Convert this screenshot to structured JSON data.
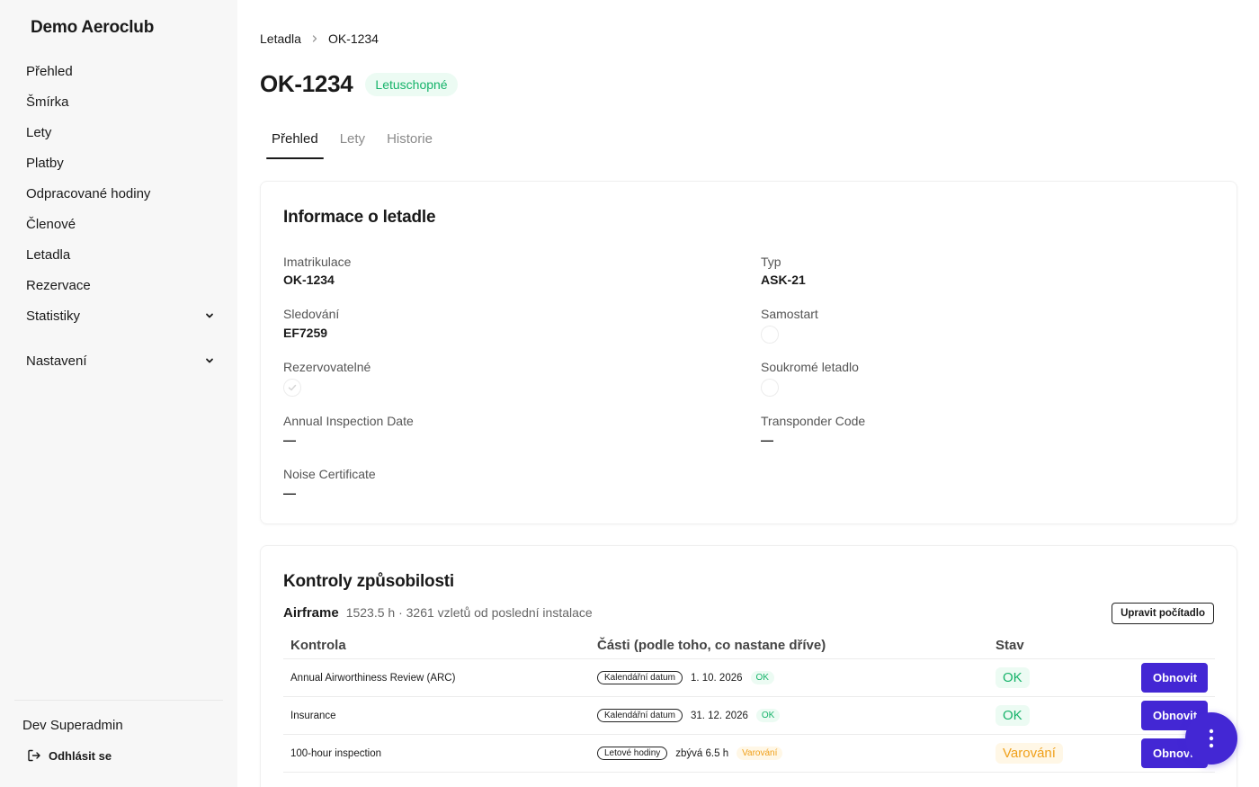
{
  "app": {
    "brand": "Demo Aeroclub"
  },
  "sidebar": {
    "items": [
      {
        "label": "Přehled"
      },
      {
        "label": "Šmírka"
      },
      {
        "label": "Lety"
      },
      {
        "label": "Platby"
      },
      {
        "label": "Odpracované hodiny"
      },
      {
        "label": "Členové"
      },
      {
        "label": "Letadla"
      },
      {
        "label": "Rezervace"
      },
      {
        "label": "Statistiky"
      },
      {
        "label": "Nastavení"
      }
    ],
    "user": "Dev Superadmin",
    "logout_label": "Odhlásit se"
  },
  "breadcrumb": {
    "parent": "Letadla",
    "current": "OK-1234"
  },
  "header": {
    "title": "OK-1234",
    "status_badge": "Letuschopné"
  },
  "tabs": [
    {
      "label": "Přehled",
      "active": true
    },
    {
      "label": "Lety",
      "active": false
    },
    {
      "label": "Historie",
      "active": false
    }
  ],
  "info": {
    "title": "Informace o letadle",
    "imatrikulace_label": "Imatrikulace",
    "imatrikulace_value": "OK-1234",
    "typ_label": "Typ",
    "typ_value": "ASK-21",
    "sledovani_label": "Sledování",
    "sledovani_value": "EF7259",
    "samostart_label": "Samostart",
    "samostart_checked": false,
    "rezervovatelne_label": "Rezervovatelné",
    "rezervovatelne_checked": true,
    "soukrome_label": "Soukromé letadlo",
    "soukrome_checked": false,
    "annual_label": "Annual Inspection Date",
    "annual_value": "—",
    "transponder_label": "Transponder Code",
    "transponder_value": "—",
    "noise_label": "Noise Certificate",
    "noise_value": "—"
  },
  "controls": {
    "title": "Kontroly způsobilosti",
    "airframe_label": "Airframe",
    "airframe_meta": "1523.5 h · 3261 vzletů od poslední instalace",
    "edit_counter_label": "Upravit počítadlo",
    "columns": {
      "check": "Kontrola",
      "parts": "Části (podle toho, co nastane dříve)",
      "status": "Stav"
    },
    "rows": [
      {
        "name": "Annual Airworthiness Review (ARC)",
        "tag": "Kalendářní datum",
        "value": "1. 10. 2026",
        "mini": "OK",
        "status": "OK",
        "action": "Obnovit"
      },
      {
        "name": "Insurance",
        "tag": "Kalendářní datum",
        "value": "31. 12. 2026",
        "mini": "OK",
        "status": "OK",
        "action": "Obnovit"
      },
      {
        "name": "100-hour inspection",
        "tag": "Letové hodiny",
        "value": "zbývá 6.5 h",
        "mini": "Varování",
        "status": "Varování",
        "action": "Obnovit"
      }
    ]
  },
  "colors": {
    "accent": "#4327d4",
    "ok": "#16b36a",
    "warn": "#f0a01a"
  },
  "icons": {
    "fab": "more-vertical-icon",
    "logout": "logout-icon",
    "chevron": "chevron-down-icon"
  }
}
